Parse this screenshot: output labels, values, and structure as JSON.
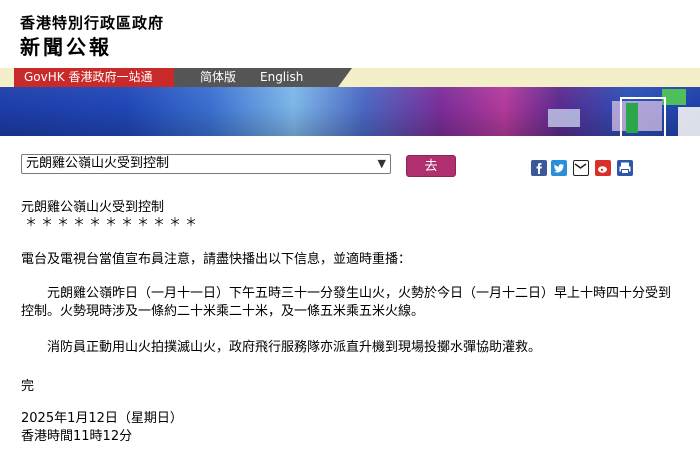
{
  "header": {
    "org_name": "香港特別行政區政府",
    "press_title": "新聞公報"
  },
  "nav": {
    "gov_portal": "GovHK 香港政府一站通",
    "simplified": "简体版",
    "english": "English"
  },
  "toolbar": {
    "select_value": "元朗雞公嶺山火受到控制",
    "go_label": "去",
    "share_icons": [
      "facebook-icon",
      "twitter-icon",
      "email-icon",
      "weibo-icon",
      "print-icon"
    ]
  },
  "article": {
    "headline": "元朗雞公嶺山火受到控制",
    "stars": "＊＊＊＊＊＊＊＊＊＊＊",
    "notice": "電台及電視台當值宣布員注意，請盡快播出以下信息，並適時重播：",
    "para1": "元朗雞公嶺昨日（一月十一日）下午五時三十一分發生山火，火勢於今日（一月十二日）早上十時四十分受到控制。火勢現時涉及一條約二十米乘二十米，及一條五米乘五米火線。",
    "para2": "消防員正動用山火拍撲滅山火，政府飛行服務隊亦派直升機到現場投擲水彈協助灌救。",
    "end": "完",
    "date": "2025年1月12日（星期日）",
    "time": "香港時間11時12分"
  },
  "colors": {
    "nav_red": "#c82a2a",
    "go_button": "#b0306f",
    "nav_bg": "#f3efc9"
  }
}
